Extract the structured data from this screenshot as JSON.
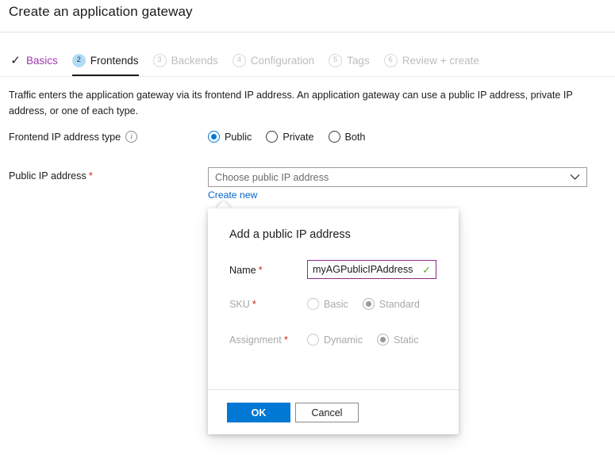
{
  "header": {
    "title": "Create an application gateway"
  },
  "wizard": {
    "tabs": [
      {
        "number": "",
        "label": "Basics",
        "state": "done"
      },
      {
        "number": "2",
        "label": "Frontends",
        "state": "current"
      },
      {
        "number": "3",
        "label": "Backends",
        "state": "disabled"
      },
      {
        "number": "4",
        "label": "Configuration",
        "state": "disabled"
      },
      {
        "number": "5",
        "label": "Tags",
        "state": "disabled"
      },
      {
        "number": "6",
        "label": "Review + create",
        "state": "disabled"
      }
    ]
  },
  "main": {
    "description": "Traffic enters the application gateway via its frontend IP address. An application gateway can use a public IP address, private IP address, or one of each type.",
    "frontend_type": {
      "label": "Frontend IP address type",
      "info_icon": "info-icon",
      "options": [
        {
          "label": "Public",
          "selected": true
        },
        {
          "label": "Private",
          "selected": false
        },
        {
          "label": "Both",
          "selected": false
        }
      ]
    },
    "public_ip": {
      "label": "Public IP address",
      "required_marker": "*",
      "dropdown_value": "Choose public IP address",
      "dropdown_icon": "chevron-down-icon",
      "create_new_link": "Create new"
    }
  },
  "dialog": {
    "title": "Add a public IP address",
    "name": {
      "label": "Name",
      "required_marker": "*",
      "value": "myAGPublicIPAddress",
      "valid_icon": "checkmark-icon"
    },
    "sku": {
      "label": "SKU",
      "required_marker": "*",
      "options": [
        {
          "label": "Basic",
          "selected": false
        },
        {
          "label": "Standard",
          "selected": true
        }
      ]
    },
    "assignment": {
      "label": "Assignment",
      "required_marker": "*",
      "options": [
        {
          "label": "Dynamic",
          "selected": false
        },
        {
          "label": "Static",
          "selected": true
        }
      ]
    },
    "ok_label": "OK",
    "cancel_label": "Cancel"
  },
  "colors": {
    "accent_blue": "#0078d4",
    "link_blue": "#0066cc",
    "visited_purple": "#a03ab0",
    "required_red": "#c42b1c",
    "valid_green": "#62a83a",
    "name_border_purple": "#8a2a8a",
    "badge_blue": "#b3dcf4"
  }
}
